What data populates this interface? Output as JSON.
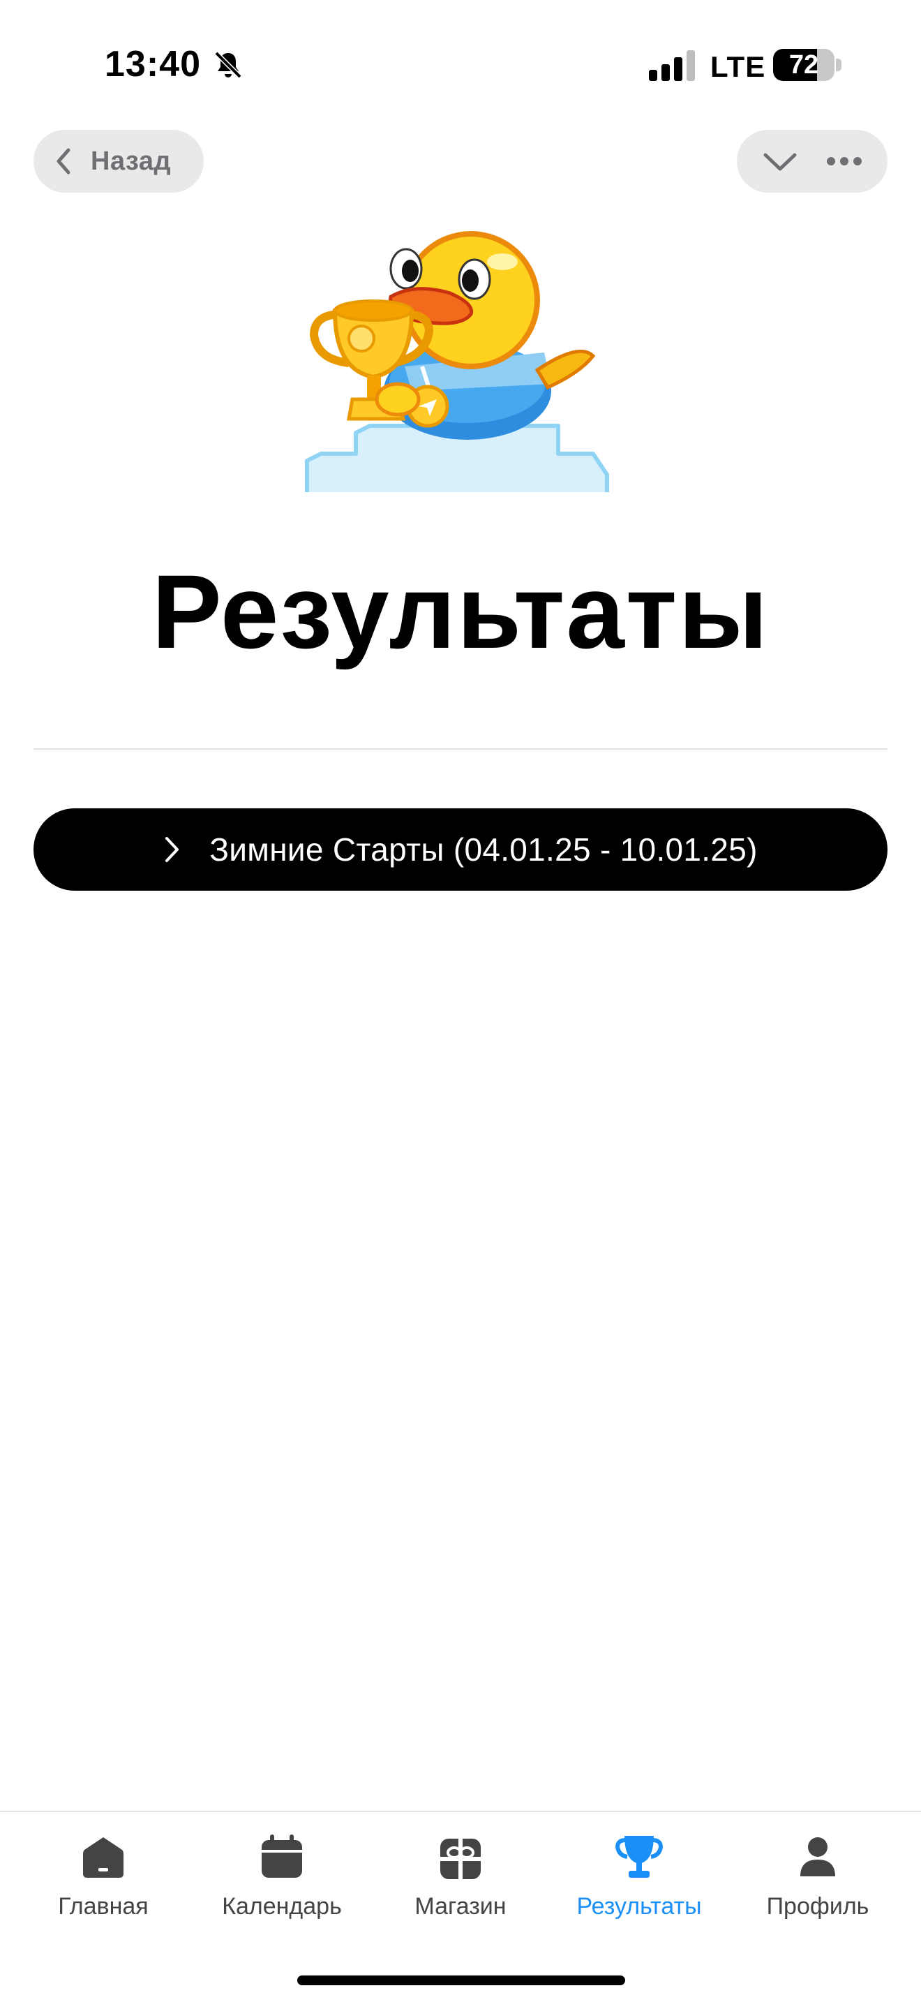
{
  "status_bar": {
    "time": "13:40",
    "network": "LTE",
    "battery": "72",
    "battery_level": 0.72
  },
  "header": {
    "back_label": "Назад"
  },
  "page": {
    "title": "Результаты",
    "events": [
      {
        "label": "Зимние Старты (04.01.25 - 10.01.25)"
      }
    ]
  },
  "tabbar": {
    "active": "results",
    "tabs": [
      {
        "id": "home",
        "label": "Главная",
        "icon": "home-icon"
      },
      {
        "id": "calendar",
        "label": "Календарь",
        "icon": "calendar-icon"
      },
      {
        "id": "shop",
        "label": "Магазин",
        "icon": "gift-icon"
      },
      {
        "id": "results",
        "label": "Результаты",
        "icon": "trophy-icon"
      },
      {
        "id": "profile",
        "label": "Профиль",
        "icon": "person-icon"
      }
    ]
  },
  "colors": {
    "accent": "#1a8ff5",
    "pill_bg": "#e9e9ea",
    "icon_inactive": "#444444"
  }
}
